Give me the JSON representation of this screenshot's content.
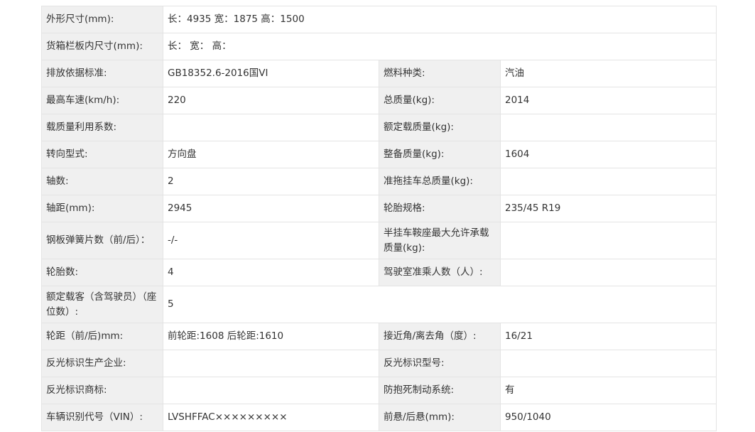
{
  "rows": [
    {
      "label": "外形尺寸(mm):",
      "value": "长：4935 宽：1875 高：1500"
    },
    {
      "label": "货箱栏板内尺寸(mm):",
      "value": "长： 宽： 高："
    },
    {
      "label": "排放依据标准:",
      "value": "GB18352.6-2016国VI",
      "label2": "燃料种类:",
      "value2": "汽油"
    },
    {
      "label": "最高车速(km/h):",
      "value": "220",
      "label2": "总质量(kg):",
      "value2": "2014"
    },
    {
      "label": "载质量利用系数:",
      "value": "",
      "label2": "额定载质量(kg):",
      "value2": ""
    },
    {
      "label": "转向型式:",
      "value": "方向盘",
      "label2": "整备质量(kg):",
      "value2": "1604"
    },
    {
      "label": "轴数:",
      "value": "2",
      "label2": "准拖挂车总质量(kg):",
      "value2": ""
    },
    {
      "label": "轴距(mm):",
      "value": "2945",
      "label2": "轮胎规格:",
      "value2": "235/45 R19"
    },
    {
      "label": "钢板弹簧片数（前/后）：",
      "value": "-/-",
      "label2": "半挂车鞍座最大允许承载质量(kg):",
      "value2": ""
    },
    {
      "label": "轮胎数:",
      "value": "4",
      "label2": "驾驶室准乘人数（人）:",
      "value2": ""
    },
    {
      "label": "额定载客（含驾驶员）（座位数）:",
      "value": "5"
    },
    {
      "label": "轮距（前/后)mm:",
      "value": "前轮距:1608 后轮距:1610",
      "label2": "接近角/离去角（度）:",
      "value2": "16/21"
    },
    {
      "label": "反光标识生产企业:",
      "value": "",
      "label2": "反光标识型号:",
      "value2": ""
    },
    {
      "label": "反光标识商标:",
      "value": "",
      "label2": "防抱死制动系统:",
      "value2": "有"
    },
    {
      "label": "车辆识别代号（VIN）:",
      "value": "LVSHFFAC×××××××××",
      "label2": "前悬/后悬(mm):",
      "value2": "950/1040"
    }
  ]
}
